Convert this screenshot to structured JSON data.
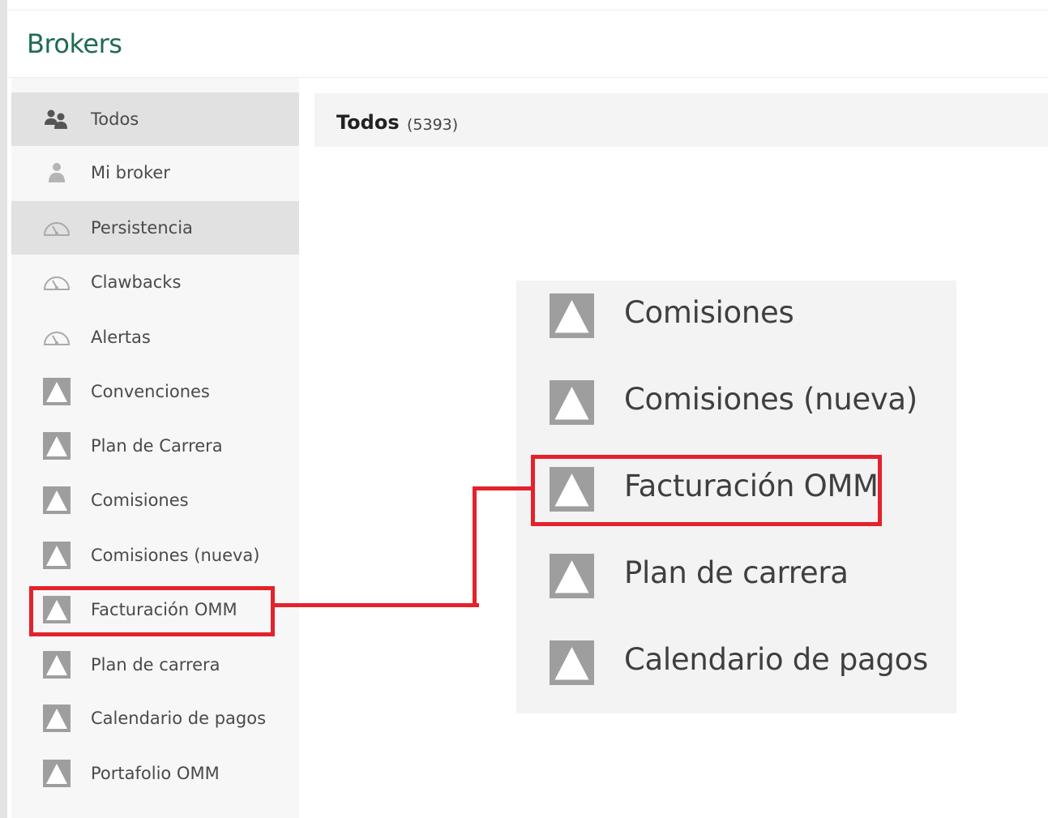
{
  "header": {
    "title": "Brokers"
  },
  "sidebar": {
    "items": [
      {
        "label": "Todos",
        "icon": "users-icon"
      },
      {
        "label": "Mi broker",
        "icon": "user-icon"
      },
      {
        "label": "Persistencia",
        "icon": "gauge-icon"
      },
      {
        "label": "Clawbacks",
        "icon": "gauge-icon"
      },
      {
        "label": "Alertas",
        "icon": "gauge-icon"
      },
      {
        "label": "Convenciones",
        "icon": "triangle-image-icon"
      },
      {
        "label": "Plan de Carrera",
        "icon": "triangle-image-icon"
      },
      {
        "label": "Comisiones",
        "icon": "triangle-image-icon"
      },
      {
        "label": "Comisiones (nueva)",
        "icon": "triangle-image-icon"
      },
      {
        "label": "Facturación OMM",
        "icon": "triangle-image-icon"
      },
      {
        "label": "Plan de carrera",
        "icon": "triangle-image-icon"
      },
      {
        "label": "Calendario de pagos",
        "icon": "triangle-image-icon"
      },
      {
        "label": "Portafolio OMM",
        "icon": "triangle-image-icon"
      }
    ]
  },
  "main": {
    "title": "Todos",
    "count": "(5393)"
  },
  "zoom": {
    "items": [
      {
        "label": "Comisiones",
        "icon": "triangle-image-icon"
      },
      {
        "label": "Comisiones (nueva)",
        "icon": "triangle-image-icon"
      },
      {
        "label": "Facturación OMM",
        "icon": "triangle-image-icon"
      },
      {
        "label": "Plan de carrera",
        "icon": "triangle-image-icon"
      },
      {
        "label": "Calendario de pagos",
        "icon": "triangle-image-icon"
      }
    ]
  },
  "colors": {
    "brand": "#1f6b4f",
    "highlight": "#e3222b",
    "active_bg": "#e1e1e1",
    "icon_gray": "#9e9e9e"
  }
}
